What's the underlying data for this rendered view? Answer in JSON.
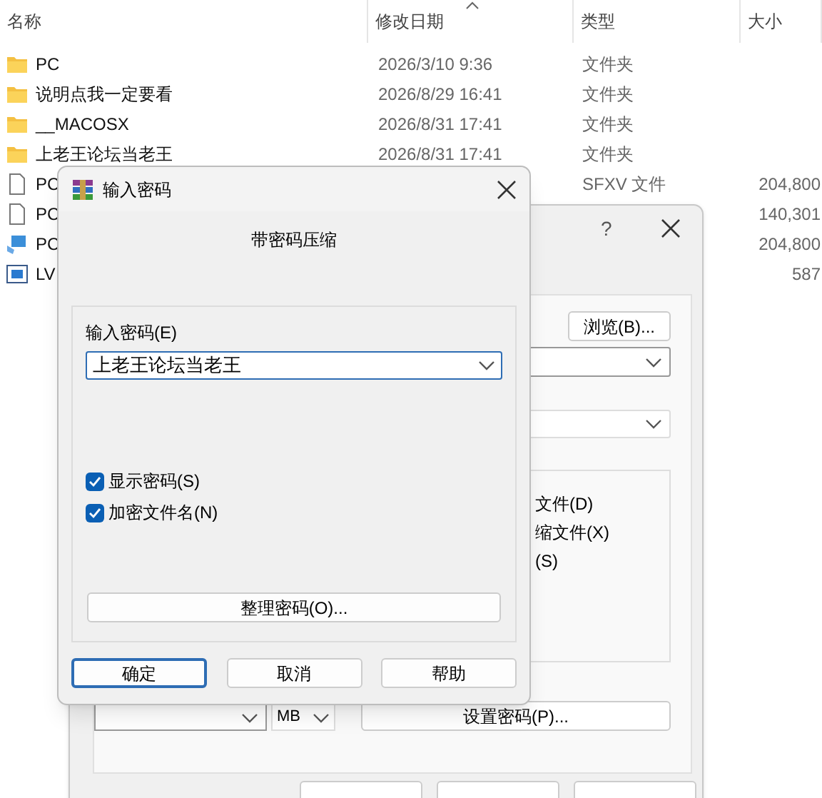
{
  "explorer": {
    "columns": [
      {
        "label": "名称",
        "sorted": false
      },
      {
        "label": "修改日期",
        "sorted": true
      },
      {
        "label": "类型",
        "sorted": false
      },
      {
        "label": "大小",
        "sorted": false
      }
    ],
    "rows": [
      {
        "kind": "folder",
        "name": "PC",
        "date": "2026/3/10 9:36",
        "type": "文件夹"
      },
      {
        "kind": "folder",
        "name": "说明点我一定要看",
        "date": "2026/8/29 16:41",
        "type": "文件夹"
      },
      {
        "kind": "folder",
        "name": "__MACOSX",
        "date": "2026/8/31 17:41",
        "type": "文件夹"
      },
      {
        "kind": "folder",
        "name": "上老王论坛当老王",
        "date": "2026/8/31 17:41",
        "type": "文件夹"
      },
      {
        "kind": "file",
        "name": "PC",
        "type": "SFXV 文件",
        "size": "204,800"
      },
      {
        "kind": "file",
        "name": "PC",
        "size": "140,301"
      },
      {
        "kind": "installer",
        "name": "PC",
        "size": "204,800"
      },
      {
        "kind": "app",
        "name": "LV",
        "size": "587"
      }
    ]
  },
  "archive_dialog": {
    "help": "?",
    "browse_button": "浏览(B)...",
    "options": [
      "文件(D)",
      "缩文件(X)",
      "(S)"
    ],
    "unit": "MB",
    "set_password_button": "设置密码(P)..."
  },
  "password_dialog": {
    "title": "输入密码",
    "heading": "带密码压缩",
    "password_label": "输入密码(E)",
    "password": "上老王论坛当老王",
    "checkboxes": [
      {
        "label": "显示密码(S)",
        "checked": true
      },
      {
        "label": "加密文件名(N)",
        "checked": true
      }
    ],
    "organize_button": "整理密码(O)...",
    "buttons": [
      {
        "label": "确定",
        "default": true
      },
      {
        "label": "取消",
        "default": false
      },
      {
        "label": "帮助",
        "default": false
      }
    ]
  }
}
